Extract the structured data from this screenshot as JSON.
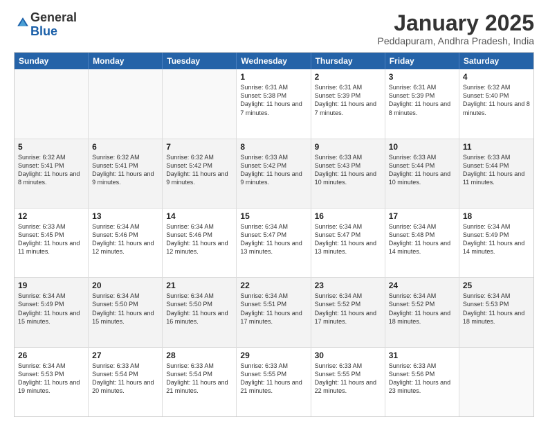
{
  "header": {
    "logo_general": "General",
    "logo_blue": "Blue",
    "month_title": "January 2025",
    "location": "Peddapuram, Andhra Pradesh, India"
  },
  "weekdays": [
    "Sunday",
    "Monday",
    "Tuesday",
    "Wednesday",
    "Thursday",
    "Friday",
    "Saturday"
  ],
  "rows": [
    [
      {
        "day": "",
        "sunrise": "",
        "sunset": "",
        "daylight": "",
        "empty": true
      },
      {
        "day": "",
        "sunrise": "",
        "sunset": "",
        "daylight": "",
        "empty": true
      },
      {
        "day": "",
        "sunrise": "",
        "sunset": "",
        "daylight": "",
        "empty": true
      },
      {
        "day": "1",
        "sunrise": "Sunrise: 6:31 AM",
        "sunset": "Sunset: 5:38 PM",
        "daylight": "Daylight: 11 hours and 7 minutes."
      },
      {
        "day": "2",
        "sunrise": "Sunrise: 6:31 AM",
        "sunset": "Sunset: 5:39 PM",
        "daylight": "Daylight: 11 hours and 7 minutes."
      },
      {
        "day": "3",
        "sunrise": "Sunrise: 6:31 AM",
        "sunset": "Sunset: 5:39 PM",
        "daylight": "Daylight: 11 hours and 8 minutes."
      },
      {
        "day": "4",
        "sunrise": "Sunrise: 6:32 AM",
        "sunset": "Sunset: 5:40 PM",
        "daylight": "Daylight: 11 hours and 8 minutes."
      }
    ],
    [
      {
        "day": "5",
        "sunrise": "Sunrise: 6:32 AM",
        "sunset": "Sunset: 5:41 PM",
        "daylight": "Daylight: 11 hours and 8 minutes."
      },
      {
        "day": "6",
        "sunrise": "Sunrise: 6:32 AM",
        "sunset": "Sunset: 5:41 PM",
        "daylight": "Daylight: 11 hours and 9 minutes."
      },
      {
        "day": "7",
        "sunrise": "Sunrise: 6:32 AM",
        "sunset": "Sunset: 5:42 PM",
        "daylight": "Daylight: 11 hours and 9 minutes."
      },
      {
        "day": "8",
        "sunrise": "Sunrise: 6:33 AM",
        "sunset": "Sunset: 5:42 PM",
        "daylight": "Daylight: 11 hours and 9 minutes."
      },
      {
        "day": "9",
        "sunrise": "Sunrise: 6:33 AM",
        "sunset": "Sunset: 5:43 PM",
        "daylight": "Daylight: 11 hours and 10 minutes."
      },
      {
        "day": "10",
        "sunrise": "Sunrise: 6:33 AM",
        "sunset": "Sunset: 5:44 PM",
        "daylight": "Daylight: 11 hours and 10 minutes."
      },
      {
        "day": "11",
        "sunrise": "Sunrise: 6:33 AM",
        "sunset": "Sunset: 5:44 PM",
        "daylight": "Daylight: 11 hours and 11 minutes."
      }
    ],
    [
      {
        "day": "12",
        "sunrise": "Sunrise: 6:33 AM",
        "sunset": "Sunset: 5:45 PM",
        "daylight": "Daylight: 11 hours and 11 minutes."
      },
      {
        "day": "13",
        "sunrise": "Sunrise: 6:34 AM",
        "sunset": "Sunset: 5:46 PM",
        "daylight": "Daylight: 11 hours and 12 minutes."
      },
      {
        "day": "14",
        "sunrise": "Sunrise: 6:34 AM",
        "sunset": "Sunset: 5:46 PM",
        "daylight": "Daylight: 11 hours and 12 minutes."
      },
      {
        "day": "15",
        "sunrise": "Sunrise: 6:34 AM",
        "sunset": "Sunset: 5:47 PM",
        "daylight": "Daylight: 11 hours and 13 minutes."
      },
      {
        "day": "16",
        "sunrise": "Sunrise: 6:34 AM",
        "sunset": "Sunset: 5:47 PM",
        "daylight": "Daylight: 11 hours and 13 minutes."
      },
      {
        "day": "17",
        "sunrise": "Sunrise: 6:34 AM",
        "sunset": "Sunset: 5:48 PM",
        "daylight": "Daylight: 11 hours and 14 minutes."
      },
      {
        "day": "18",
        "sunrise": "Sunrise: 6:34 AM",
        "sunset": "Sunset: 5:49 PM",
        "daylight": "Daylight: 11 hours and 14 minutes."
      }
    ],
    [
      {
        "day": "19",
        "sunrise": "Sunrise: 6:34 AM",
        "sunset": "Sunset: 5:49 PM",
        "daylight": "Daylight: 11 hours and 15 minutes."
      },
      {
        "day": "20",
        "sunrise": "Sunrise: 6:34 AM",
        "sunset": "Sunset: 5:50 PM",
        "daylight": "Daylight: 11 hours and 15 minutes."
      },
      {
        "day": "21",
        "sunrise": "Sunrise: 6:34 AM",
        "sunset": "Sunset: 5:50 PM",
        "daylight": "Daylight: 11 hours and 16 minutes."
      },
      {
        "day": "22",
        "sunrise": "Sunrise: 6:34 AM",
        "sunset": "Sunset: 5:51 PM",
        "daylight": "Daylight: 11 hours and 17 minutes."
      },
      {
        "day": "23",
        "sunrise": "Sunrise: 6:34 AM",
        "sunset": "Sunset: 5:52 PM",
        "daylight": "Daylight: 11 hours and 17 minutes."
      },
      {
        "day": "24",
        "sunrise": "Sunrise: 6:34 AM",
        "sunset": "Sunset: 5:52 PM",
        "daylight": "Daylight: 11 hours and 18 minutes."
      },
      {
        "day": "25",
        "sunrise": "Sunrise: 6:34 AM",
        "sunset": "Sunset: 5:53 PM",
        "daylight": "Daylight: 11 hours and 18 minutes."
      }
    ],
    [
      {
        "day": "26",
        "sunrise": "Sunrise: 6:34 AM",
        "sunset": "Sunset: 5:53 PM",
        "daylight": "Daylight: 11 hours and 19 minutes."
      },
      {
        "day": "27",
        "sunrise": "Sunrise: 6:33 AM",
        "sunset": "Sunset: 5:54 PM",
        "daylight": "Daylight: 11 hours and 20 minutes."
      },
      {
        "day": "28",
        "sunrise": "Sunrise: 6:33 AM",
        "sunset": "Sunset: 5:54 PM",
        "daylight": "Daylight: 11 hours and 21 minutes."
      },
      {
        "day": "29",
        "sunrise": "Sunrise: 6:33 AM",
        "sunset": "Sunset: 5:55 PM",
        "daylight": "Daylight: 11 hours and 21 minutes."
      },
      {
        "day": "30",
        "sunrise": "Sunrise: 6:33 AM",
        "sunset": "Sunset: 5:55 PM",
        "daylight": "Daylight: 11 hours and 22 minutes."
      },
      {
        "day": "31",
        "sunrise": "Sunrise: 6:33 AM",
        "sunset": "Sunset: 5:56 PM",
        "daylight": "Daylight: 11 hours and 23 minutes."
      },
      {
        "day": "",
        "sunrise": "",
        "sunset": "",
        "daylight": "",
        "empty": true
      }
    ]
  ]
}
